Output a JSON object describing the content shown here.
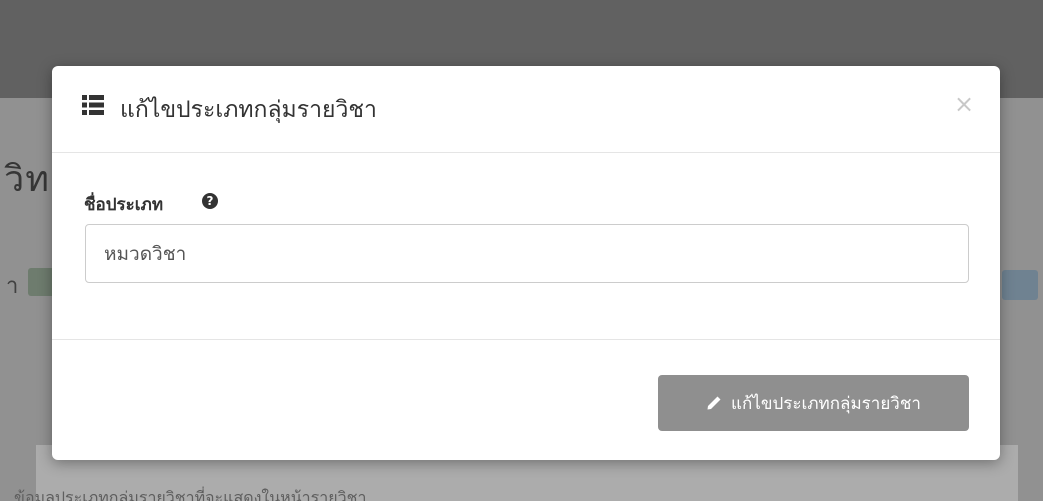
{
  "background": {
    "page_title_fragment": "วิทย",
    "label_fragment": "า",
    "bottom_text_fragment": "ข้อมูลประเภทกลุ่มรายวิชาที่จะแสดงในหน้ารายวิชา"
  },
  "modal": {
    "title": "แก้ไขประเภทกลุ่มรายวิชา",
    "title_icon": "list-icon",
    "close_label": "×",
    "field": {
      "label": "ชื่อประเภท",
      "help_icon": "question-circle-icon",
      "help_glyph": "?",
      "value": "หมวดวิชา"
    },
    "submit": {
      "icon": "pencil-icon",
      "label": "แก้ไขประเภทกลุ่มรายวิชา",
      "color": "#8f8f8f"
    }
  }
}
